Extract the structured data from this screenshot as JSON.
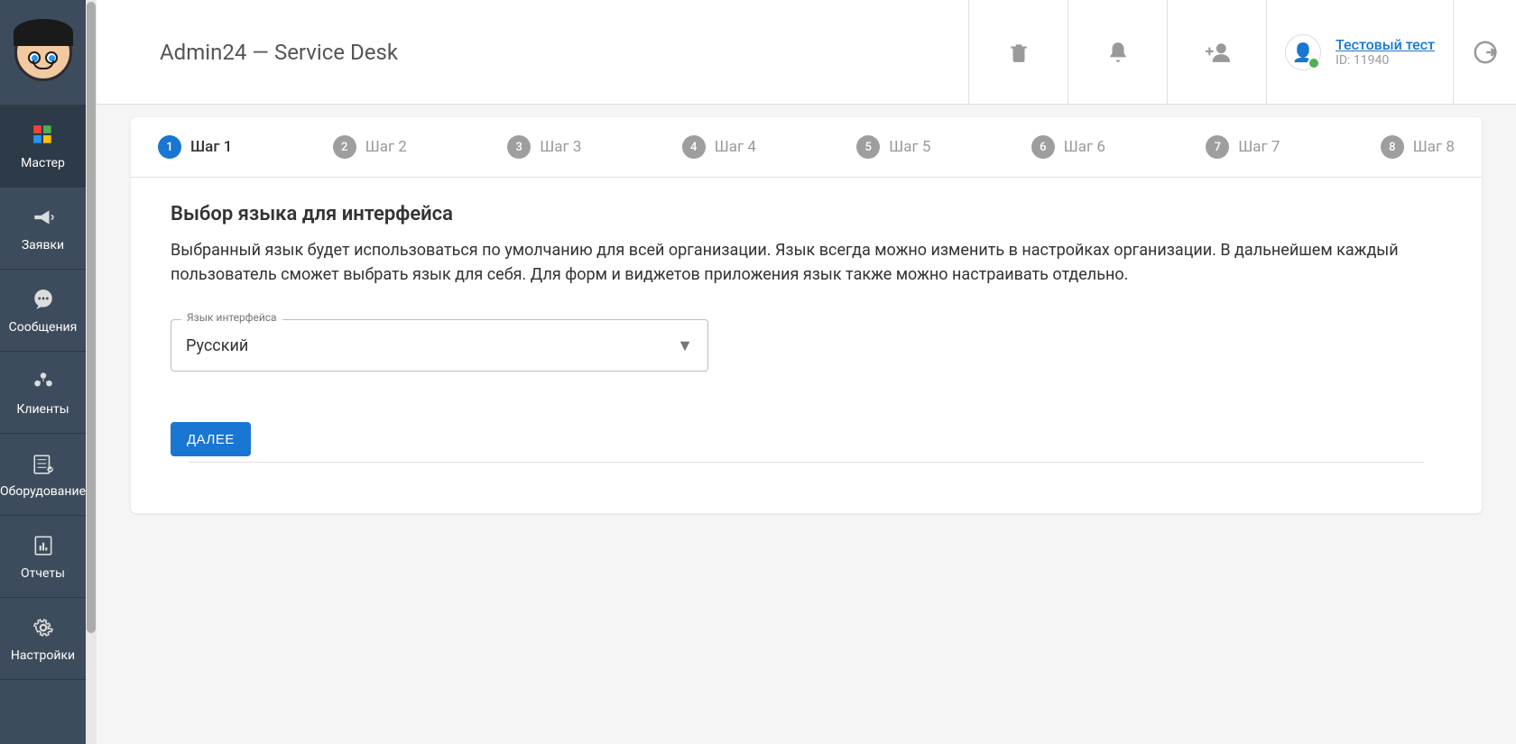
{
  "header": {
    "title": "Admin24 — Service Desk",
    "user": {
      "name": "Тестовый тест",
      "id_prefix": "ID:",
      "id": "11940"
    }
  },
  "sidebar": {
    "items": [
      {
        "label": "Мастер",
        "icon": "wizard"
      },
      {
        "label": "Заявки",
        "icon": "megaphone"
      },
      {
        "label": "Сообщения",
        "icon": "chat"
      },
      {
        "label": "Клиенты",
        "icon": "clients"
      },
      {
        "label": "Оборудование",
        "icon": "equipment"
      },
      {
        "label": "Отчеты",
        "icon": "reports"
      },
      {
        "label": "Настройки",
        "icon": "gear"
      }
    ]
  },
  "stepper": {
    "steps": [
      {
        "num": "1",
        "label": "Шаг 1",
        "active": true
      },
      {
        "num": "2",
        "label": "Шаг 2",
        "active": false
      },
      {
        "num": "3",
        "label": "Шаг 3",
        "active": false
      },
      {
        "num": "4",
        "label": "Шаг 4",
        "active": false
      },
      {
        "num": "5",
        "label": "Шаг 5",
        "active": false
      },
      {
        "num": "6",
        "label": "Шаг 6",
        "active": false
      },
      {
        "num": "7",
        "label": "Шаг 7",
        "active": false
      },
      {
        "num": "8",
        "label": "Шаг 8",
        "active": false
      }
    ]
  },
  "form": {
    "title": "Выбор языка для интерфейса",
    "description": "Выбранный язык будет использоваться по умолчанию для всей организации. Язык всегда можно изменить в настройках организации. В дальнейшем каждый пользователь сможет выбрать язык для себя. Для форм и виджетов приложения язык также можно настраивать отдельно.",
    "language_select": {
      "label": "Язык интерфейса",
      "value": "Русский"
    },
    "next_button": "ДАЛЕЕ"
  }
}
